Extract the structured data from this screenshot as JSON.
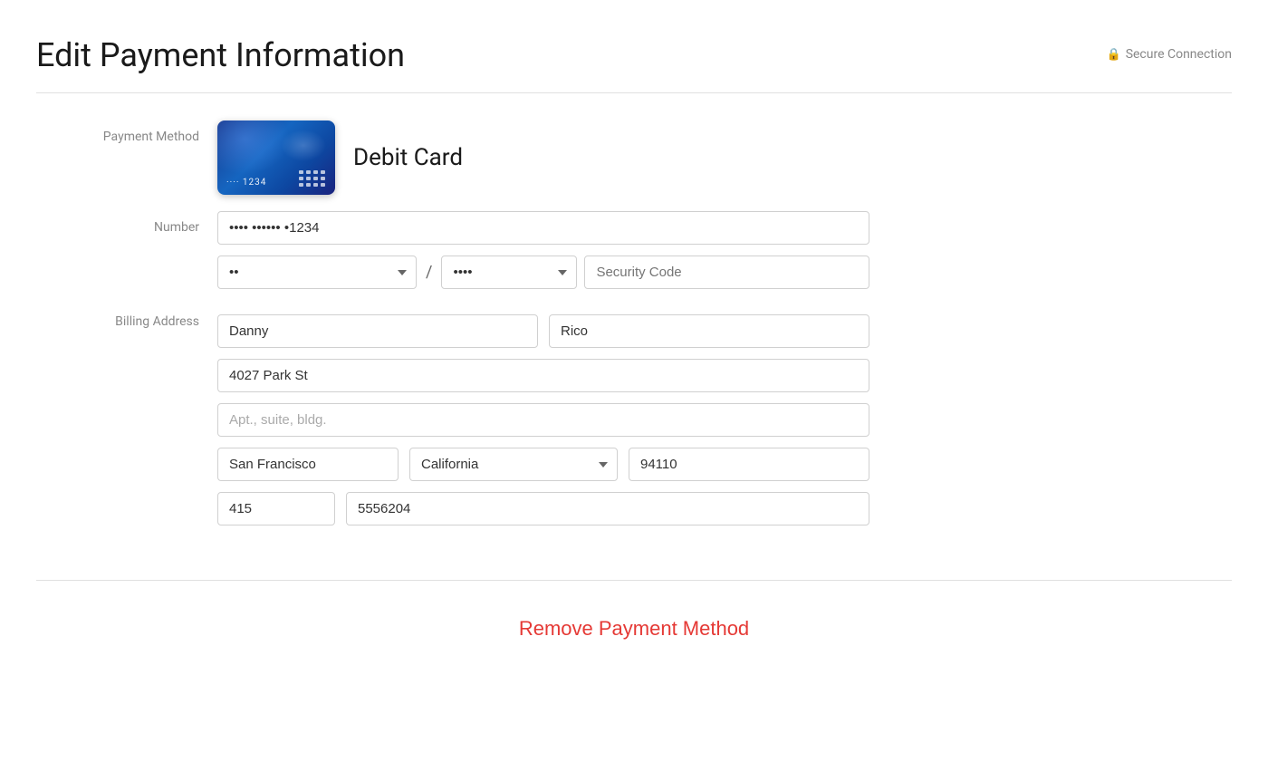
{
  "header": {
    "title": "Edit Payment Information",
    "secure_label": "Secure Connection"
  },
  "payment_method": {
    "label": "Payment Method",
    "type": "Debit Card",
    "card_number_display": "···· 1234"
  },
  "number_field": {
    "label": "Number",
    "value": "•••• •••••• •1234",
    "placeholder": "•••• •••••• •1234"
  },
  "expiry": {
    "month_value": "••",
    "year_value": "••••",
    "security_code_placeholder": "Security Code"
  },
  "billing_address": {
    "label": "Billing Address",
    "first_name": "Danny",
    "last_name": "Rico",
    "street": "4027 Park St",
    "apt_placeholder": "Apt., suite, bldg.",
    "city": "San Francisco",
    "state": "California",
    "zip": "94110",
    "area_code": "415",
    "phone_number": "5556204"
  },
  "actions": {
    "remove_label": "Remove Payment Method"
  }
}
